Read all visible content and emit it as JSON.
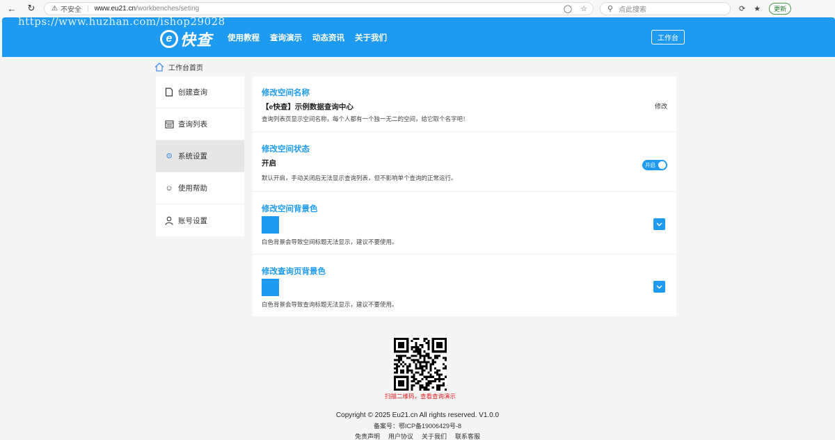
{
  "browser": {
    "insecure_label": "不安全",
    "url_domain": "www.eu21.cn",
    "url_path": "/workbenches/seting",
    "search_placeholder": "点此搜索",
    "update_label": "更新",
    "watermark": "https://www.huzhan.com/ishop29028"
  },
  "header": {
    "logo_mark": "e",
    "logo_text": "快查",
    "nav": [
      "使用教程",
      "查询演示",
      "动态资讯",
      "关于我们"
    ],
    "workbench_button": "工作台"
  },
  "breadcrumb": {
    "home": "工作台首页"
  },
  "sidebar": {
    "items": [
      {
        "label": "创建查询",
        "icon": "document-icon",
        "active": false
      },
      {
        "label": "查询列表",
        "icon": "calendar-list-icon",
        "active": false
      },
      {
        "label": "系统设置",
        "icon": "gear-icon",
        "active": true
      },
      {
        "label": "使用帮助",
        "icon": "help-smile-icon",
        "active": false
      },
      {
        "label": "账号设置",
        "icon": "user-icon",
        "active": false
      }
    ]
  },
  "settings": {
    "space_name": {
      "title": "修改空间名称",
      "value": "【e快查】示例数据查询中心",
      "desc": "查询列表页显示空间名称，每个人都有一个独一无二的空间，给它取个名字吧！",
      "edit": "修改"
    },
    "space_status": {
      "title": "修改空间状态",
      "value": "开启",
      "desc": "默认开启，手动关闭后无法显示查询列表，但不影响单个查询的正常运行。",
      "toggle_label": "开启",
      "on": true
    },
    "space_bg": {
      "title": "修改空间背景色",
      "color": "#1e9bf0",
      "desc": "白色背景会导致空间标题无法显示，建议不要使用。"
    },
    "query_bg": {
      "title": "修改查询页背景色",
      "color": "#1e9bf0",
      "desc": "白色背景会导致查询标题无法显示，建议不要使用。"
    }
  },
  "qr": {
    "caption": "扫描二维码，查看查询演示"
  },
  "footer": {
    "copyright": "Copyright © 2025 Eu21.cn All rights reserved. V1.0.0",
    "icp": "备案号：鄂ICP备19006429号-8",
    "links": [
      "免责声明",
      "用户协议",
      "关于我们",
      "联系客服"
    ]
  },
  "colors": {
    "brand": "#1e9bf0",
    "qr_caption": "#e02020"
  }
}
